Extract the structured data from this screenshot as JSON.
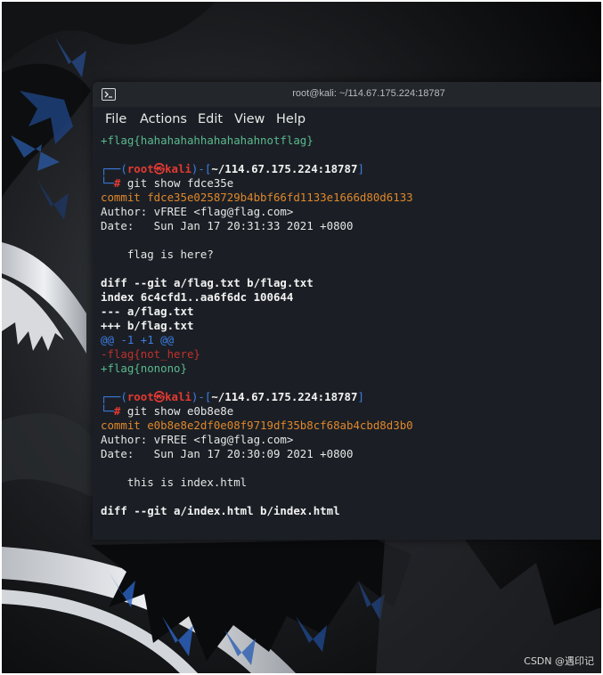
{
  "window": {
    "title": "root@kali: ~/114.67.175.224:18787"
  },
  "menu": {
    "items": [
      "File",
      "Actions",
      "Edit",
      "View",
      "Help"
    ]
  },
  "terminal": {
    "lines": [
      {
        "segments": [
          {
            "text": "+flag{hahahahahhahahahahnotflag}",
            "style": "green"
          }
        ]
      },
      {
        "segments": [
          {
            "text": "",
            "style": "plain"
          }
        ]
      },
      {
        "segments": [
          {
            "text": "┌──(",
            "style": "blue"
          },
          {
            "text": "root㉿kali",
            "style": "redb"
          },
          {
            "text": ")-[",
            "style": "blue"
          },
          {
            "text": "~/114.67.175.224:18787",
            "style": "bold"
          },
          {
            "text": "]",
            "style": "blue"
          }
        ]
      },
      {
        "segments": [
          {
            "text": "└─",
            "style": "blue"
          },
          {
            "text": "# ",
            "style": "redb"
          },
          {
            "text": "git show fdce35e",
            "style": "plain"
          }
        ]
      },
      {
        "segments": [
          {
            "text": "commit fdce35e0258729b4bbf66fd1133e1666d80d6133",
            "style": "orange"
          }
        ]
      },
      {
        "segments": [
          {
            "text": "Author: vFREE <flag@flag.com>",
            "style": "plain"
          }
        ]
      },
      {
        "segments": [
          {
            "text": "Date:   Sun Jan 17 20:31:33 2021 +0800",
            "style": "plain"
          }
        ]
      },
      {
        "segments": [
          {
            "text": "",
            "style": "plain"
          }
        ]
      },
      {
        "segments": [
          {
            "text": "    flag is here?",
            "style": "plain"
          }
        ]
      },
      {
        "segments": [
          {
            "text": "",
            "style": "plain"
          }
        ]
      },
      {
        "segments": [
          {
            "text": "diff --git a/flag.txt b/flag.txt",
            "style": "bold"
          }
        ]
      },
      {
        "segments": [
          {
            "text": "index 6c4cfd1..aa6f6dc 100644",
            "style": "bold"
          }
        ]
      },
      {
        "segments": [
          {
            "text": "--- a/flag.txt",
            "style": "bold"
          }
        ]
      },
      {
        "segments": [
          {
            "text": "+++ b/flag.txt",
            "style": "bold"
          }
        ]
      },
      {
        "segments": [
          {
            "text": "@@ -1 +1 @@",
            "style": "blue"
          }
        ]
      },
      {
        "segments": [
          {
            "text": "-flag{not_here}",
            "style": "red"
          }
        ]
      },
      {
        "segments": [
          {
            "text": "+flag{nonono}",
            "style": "green"
          }
        ]
      },
      {
        "segments": [
          {
            "text": "",
            "style": "plain"
          }
        ]
      },
      {
        "segments": [
          {
            "text": "┌──(",
            "style": "blue"
          },
          {
            "text": "root㉿kali",
            "style": "redb"
          },
          {
            "text": ")-[",
            "style": "blue"
          },
          {
            "text": "~/114.67.175.224:18787",
            "style": "bold"
          },
          {
            "text": "]",
            "style": "blue"
          }
        ]
      },
      {
        "segments": [
          {
            "text": "└─",
            "style": "blue"
          },
          {
            "text": "# ",
            "style": "redb"
          },
          {
            "text": "git show e0b8e8e",
            "style": "plain"
          }
        ]
      },
      {
        "segments": [
          {
            "text": "commit e0b8e8e2df0e08f9719df35b8cf68ab4cbd8d3b0",
            "style": "orange"
          }
        ]
      },
      {
        "segments": [
          {
            "text": "Author: vFREE <flag@flag.com>",
            "style": "plain"
          }
        ]
      },
      {
        "segments": [
          {
            "text": "Date:   Sun Jan 17 20:30:09 2021 +0800",
            "style": "plain"
          }
        ]
      },
      {
        "segments": [
          {
            "text": "",
            "style": "plain"
          }
        ]
      },
      {
        "segments": [
          {
            "text": "    this is index.html",
            "style": "plain"
          }
        ]
      },
      {
        "segments": [
          {
            "text": "",
            "style": "plain"
          }
        ]
      },
      {
        "segments": [
          {
            "text": "diff --git a/index.html b/index.html",
            "style": "bold"
          }
        ]
      }
    ]
  },
  "watermark": {
    "text": "CSDN @遇印记"
  },
  "colors": {
    "terminal_bg": "#1b1f25",
    "prompt_blue": "#3d7ee6",
    "prompt_red": "#e43932",
    "diff_green": "#5ab98e",
    "diff_red": "#c1302b",
    "commit_orange": "#e0872a"
  },
  "icons": {
    "terminal": "terminal-window-icon"
  }
}
